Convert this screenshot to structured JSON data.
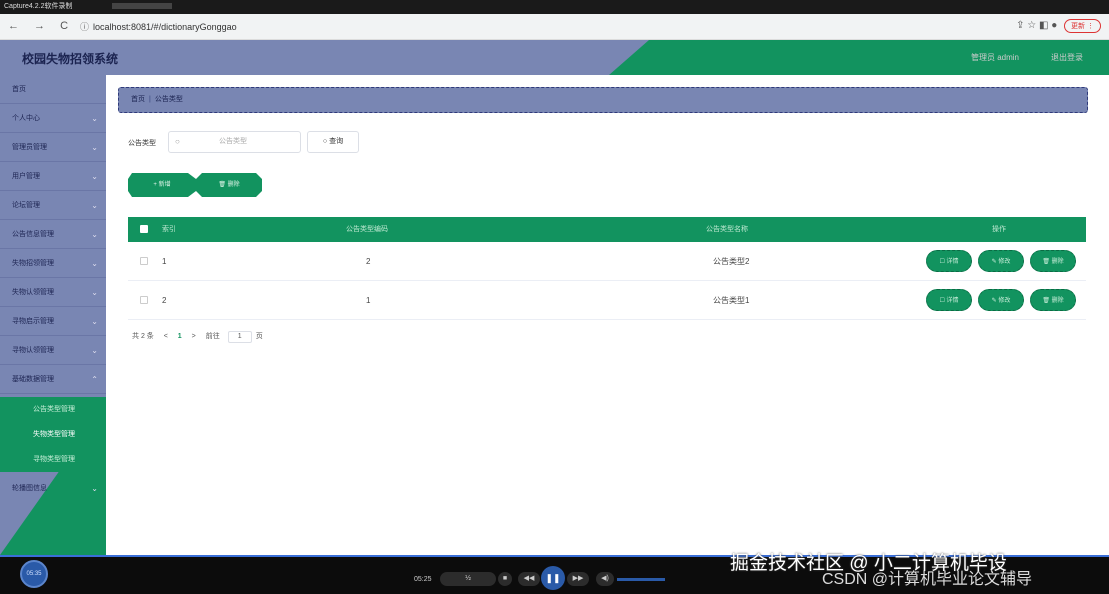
{
  "os_strip": {
    "title": "Capture4.2.2软件录制"
  },
  "browser": {
    "nav": "←  →  C",
    "url_icon": "ⓘ",
    "url": "localhost:8081/#/dictionaryGonggao",
    "update_label": "更新 ⋮"
  },
  "header": {
    "title": "校园失物招领系统",
    "user": "管理员 admin",
    "logout": "退出登录",
    "colors": {
      "blue": "#7986b3",
      "green": "#12935f"
    }
  },
  "sidebar": {
    "items": [
      {
        "label": "首页",
        "chevron": ""
      },
      {
        "label": "个人中心",
        "chevron": "⌄"
      },
      {
        "label": "管理员管理",
        "chevron": "⌄"
      },
      {
        "label": "用户管理",
        "chevron": "⌄"
      },
      {
        "label": "论坛管理",
        "chevron": "⌄"
      },
      {
        "label": "公告信息管理",
        "chevron": "⌄"
      },
      {
        "label": "失物招领管理",
        "chevron": "⌄"
      },
      {
        "label": "失物认领管理",
        "chevron": "⌄"
      },
      {
        "label": "寻物启示管理",
        "chevron": "⌄"
      },
      {
        "label": "寻物认领管理",
        "chevron": "⌄"
      },
      {
        "label": "基础数据管理",
        "chevron": "⌃"
      }
    ],
    "sub_items": [
      {
        "label": "公告类型管理"
      },
      {
        "label": "失物类型管理"
      },
      {
        "label": "寻物类型管理"
      }
    ],
    "last_item": {
      "label": "轮播图信息",
      "chevron": "⌄"
    }
  },
  "breadcrumb": {
    "home": "首页",
    "separator": "|",
    "current": "公告类型"
  },
  "search": {
    "label": "公告类型",
    "icon": "○",
    "placeholder": "公告类型",
    "button": "○ 查询"
  },
  "actions": {
    "add": "+ 新增",
    "delete": "🗑 删除"
  },
  "table": {
    "headers": {
      "index": "索引",
      "code": "公告类型编码",
      "name": "公告类型名称",
      "ops": "操作"
    },
    "rows": [
      {
        "index": "1",
        "code": "2",
        "name": "公告类型2"
      },
      {
        "index": "2",
        "code": "1",
        "name": "公告类型1"
      }
    ],
    "row_buttons": {
      "detail": "☐ 详情",
      "edit": "✎ 修改",
      "delete": "🗑 删除"
    }
  },
  "pager": {
    "total": "共 2 条",
    "prev": "<",
    "current": "1",
    "next": ">",
    "goto": "前往",
    "page_value": "1",
    "page_unit": "页"
  },
  "player": {
    "bubble": "05:35",
    "time": "05:25",
    "play_icon": "❚❚",
    "speed": "½",
    "stop": "■",
    "rewind": "◀◀",
    "forward": "▶▶",
    "volume_icon": "◀)"
  },
  "watermark": {
    "line1": "掘金技术社区 @ 小二计算机毕设",
    "line2": "CSDN @计算机毕业论文辅导"
  }
}
